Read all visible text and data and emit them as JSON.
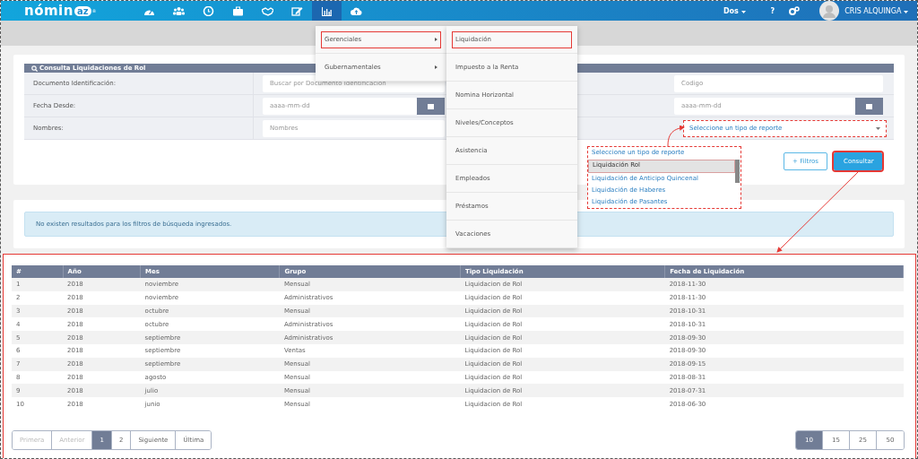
{
  "navbar": {
    "logo": {
      "text": "nómin",
      "badge": "az",
      "mark": "®"
    },
    "icons": [
      {
        "kind": "dashboard",
        "selected": false
      },
      {
        "kind": "users",
        "selected": false
      },
      {
        "kind": "clock",
        "selected": false
      },
      {
        "kind": "briefcase",
        "selected": false
      },
      {
        "kind": "handshake",
        "selected": false
      },
      {
        "kind": "edit",
        "selected": false
      },
      {
        "kind": "chart",
        "selected": true
      },
      {
        "kind": "upload",
        "selected": false
      }
    ],
    "company": "Dos",
    "help": "?",
    "user": "CRIS ALQUINGA"
  },
  "menu": [
    {
      "label": "Gerenciales",
      "highlighted": true
    },
    {
      "label": "Gubernamentales",
      "highlighted": false
    }
  ],
  "submenu": [
    {
      "label": "Liquidación",
      "highlighted": true
    },
    {
      "label": "Impuesto a la Renta",
      "highlighted": false
    },
    {
      "label": "Nomina Horizontal",
      "highlighted": false
    },
    {
      "label": "Niveles/Conceptos",
      "highlighted": false
    },
    {
      "label": "Asistencia",
      "highlighted": false
    },
    {
      "label": "Empleados",
      "highlighted": false
    },
    {
      "label": "Préstamos",
      "highlighted": false
    },
    {
      "label": "Vacaciones",
      "highlighted": false
    }
  ],
  "form": {
    "title": "Consulta Liquidaciones de Rol",
    "rows": [
      {
        "label": "Documento Identificación:",
        "placeholder": "Buscar por Documento Identificación",
        "kind": "text",
        "right": {
          "kind": "text",
          "placeholder": "Codigo"
        }
      },
      {
        "label": "Fecha Desde:",
        "placeholder": "aaaa-mm-dd",
        "kind": "date",
        "right": {
          "kind": "date",
          "placeholder": "aaaa-mm-dd"
        }
      },
      {
        "label": "Nombres:",
        "placeholder": "Nombres",
        "kind": "text",
        "right": {
          "kind": "select",
          "value": "Seleccione un tipo de reporte"
        }
      }
    ],
    "listbox": {
      "header": "Seleccione un tipo de reporte",
      "options": [
        {
          "label": "Liquidación Rol",
          "selected": true
        },
        {
          "label": "Liquidación de Anticipo Quincenal",
          "selected": false
        },
        {
          "label": "Liquidación de Haberes",
          "selected": false
        },
        {
          "label": "Liquidación de Pasantes",
          "selected": false
        }
      ]
    },
    "buttons": [
      {
        "label": "+ Filtros",
        "kind": "outline",
        "highlighted": false
      },
      {
        "label": "Consultar",
        "kind": "primary",
        "highlighted": true
      }
    ]
  },
  "alert": "No existen resultados para los filtros de búsqueda ingresados.",
  "table": {
    "columns": [
      "#",
      "Año",
      "Mes",
      "Grupo",
      "Tipo Liquidación",
      "Fecha de Liquidación"
    ],
    "rows": [
      [
        "1",
        "2018",
        "noviembre",
        "Mensual",
        "Liquidacion de Rol",
        "2018-11-30"
      ],
      [
        "2",
        "2018",
        "noviembre",
        "Administrativos",
        "Liquidacion de Rol",
        "2018-11-30"
      ],
      [
        "3",
        "2018",
        "octubre",
        "Mensual",
        "Liquidacion de Rol",
        "2018-10-31"
      ],
      [
        "4",
        "2018",
        "octubre",
        "Administrativos",
        "Liquidacion de Rol",
        "2018-10-31"
      ],
      [
        "5",
        "2018",
        "septiembre",
        "Administrativos",
        "Liquidacion de Rol",
        "2018-09-30"
      ],
      [
        "6",
        "2018",
        "septiembre",
        "Ventas",
        "Liquidacion de Rol",
        "2018-09-30"
      ],
      [
        "7",
        "2018",
        "septiembre",
        "Mensual",
        "Liquidacion de Rol",
        "2018-09-15"
      ],
      [
        "8",
        "2018",
        "agosto",
        "Mensual",
        "Liquidacion de Rol",
        "2018-08-31"
      ],
      [
        "9",
        "2018",
        "julio",
        "Mensual",
        "Liquidacion de Rol",
        "2018-07-31"
      ],
      [
        "10",
        "2018",
        "junio",
        "Mensual",
        "Liquidacion de Rol",
        "2018-06-30"
      ]
    ]
  },
  "pagination": [
    {
      "label": "Primera",
      "selected": false,
      "disabled": true
    },
    {
      "label": "Anterior",
      "selected": false,
      "disabled": true
    },
    {
      "label": "1",
      "selected": true,
      "disabled": false
    },
    {
      "label": "2",
      "selected": false,
      "disabled": false
    },
    {
      "label": "Siguiente",
      "selected": false,
      "disabled": false
    },
    {
      "label": "Última",
      "selected": false,
      "disabled": false
    }
  ],
  "page_sizes": [
    {
      "label": "10",
      "selected": true
    },
    {
      "label": "15",
      "selected": false
    },
    {
      "label": "25",
      "selected": false
    },
    {
      "label": "50",
      "selected": false
    }
  ]
}
